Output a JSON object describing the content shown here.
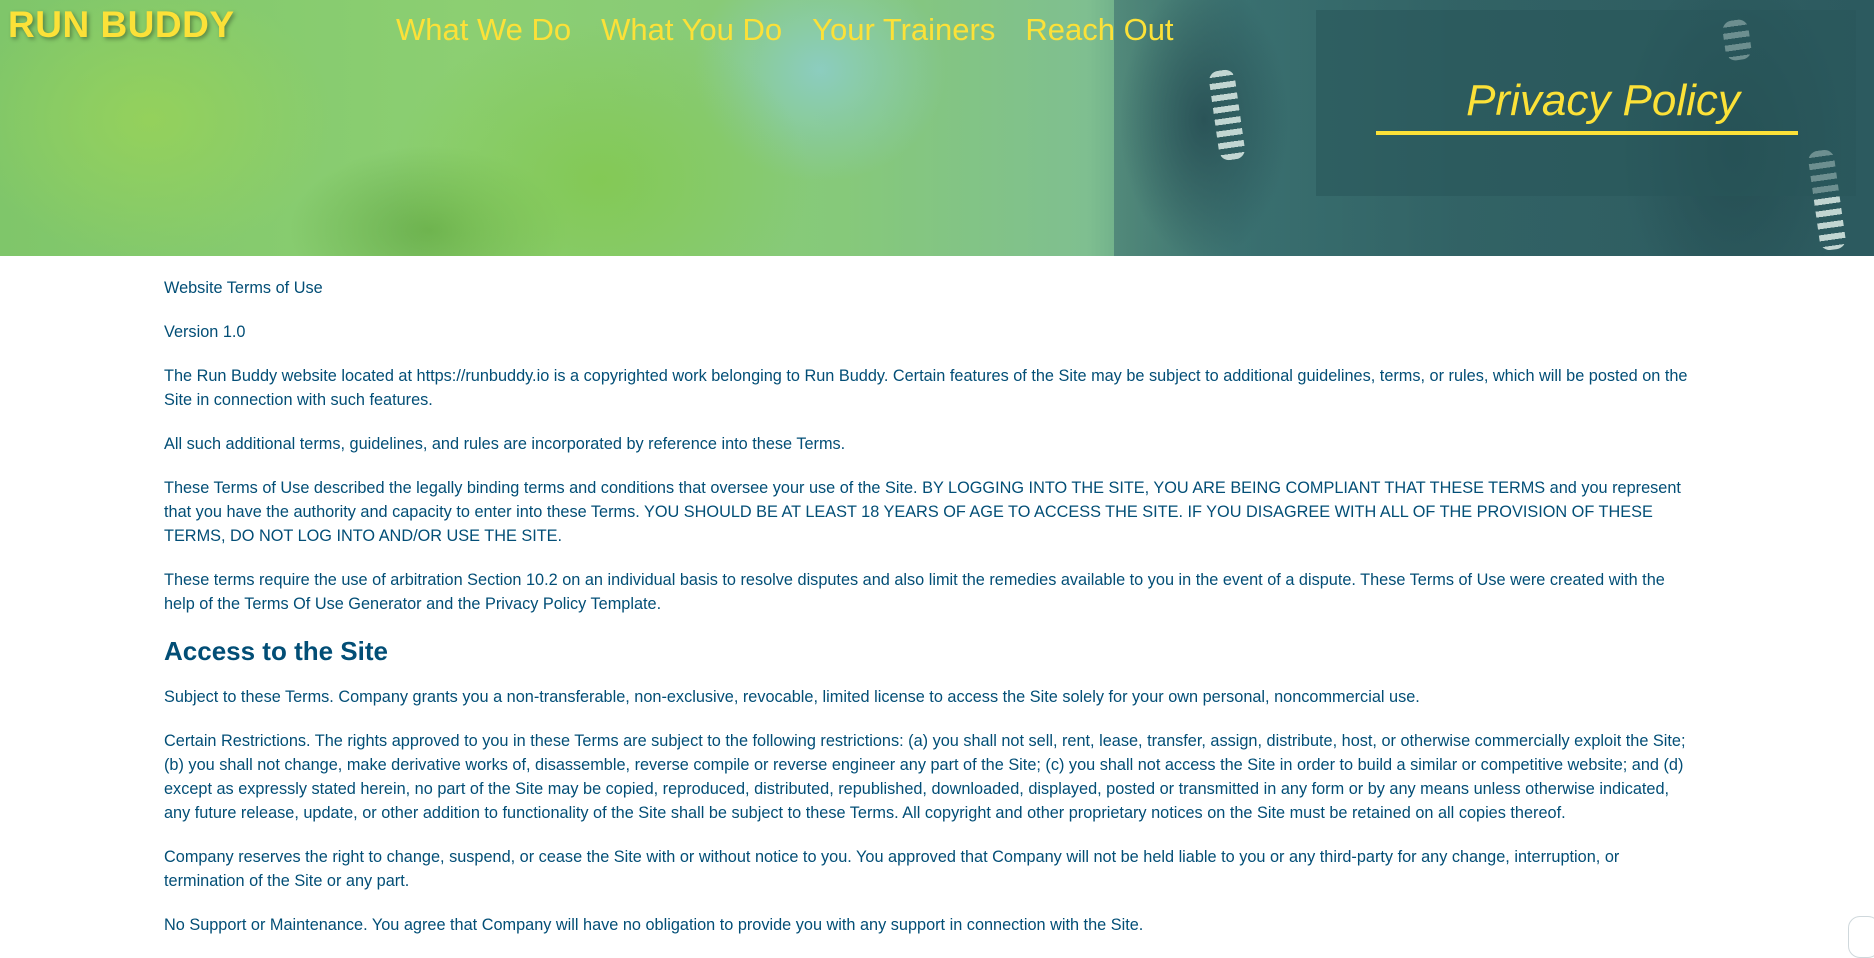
{
  "header": {
    "logo": "RUN BUDDY",
    "nav": [
      "What We Do",
      "What You Do",
      "Your Trainers",
      "Reach Out"
    ],
    "page_title": "Privacy Policy"
  },
  "content": {
    "paragraphs_intro": [
      "Website Terms of Use",
      "Version 1.0",
      "The Run Buddy website located at https://runbuddy.io is a copyrighted work belonging to Run Buddy. Certain features of the Site may be subject to additional guidelines, terms, or rules, which will be posted on the Site in connection with such features.",
      "All such additional terms, guidelines, and rules are incorporated by reference into these Terms.",
      "These Terms of Use described the legally binding terms and conditions that oversee your use of the Site. BY LOGGING INTO THE SITE, YOU ARE BEING COMPLIANT THAT THESE TERMS and you represent that you have the authority and capacity to enter into these Terms. YOU SHOULD BE AT LEAST 18 YEARS OF AGE TO ACCESS THE SITE. IF YOU DISAGREE WITH ALL OF THE PROVISION OF THESE TERMS, DO NOT LOG INTO AND/OR USE THE SITE.",
      "These terms require the use of arbitration Section 10.2 on an individual basis to resolve disputes and also limit the remedies available to you in the event of a dispute. These Terms of Use were created with the help of the Terms Of Use Generator and the Privacy Policy Template."
    ],
    "section_heading": "Access to the Site",
    "paragraphs_access": [
      "Subject to these Terms. Company grants you a non-transferable, non-exclusive, revocable, limited license to access the Site solely for your own personal, noncommercial use.",
      "Certain Restrictions. The rights approved to you in these Terms are subject to the following restrictions: (a) you shall not sell, rent, lease, transfer, assign, distribute, host, or otherwise commercially exploit the Site; (b) you shall not change, make derivative works of, disassemble, reverse compile or reverse engineer any part of the Site; (c) you shall not access the Site in order to build a similar or competitive website; and (d) except as expressly stated herein, no part of the Site may be copied, reproduced, distributed, republished, downloaded, displayed, posted or transmitted in any form or by any means unless otherwise indicated, any future release, update, or other addition to functionality of the Site shall be subject to these Terms. All copyright and other proprietary notices on the Site must be retained on all copies thereof.",
      "Company reserves the right to change, suspend, or cease the Site with or without notice to you. You approved that Company will not be held liable to you or any third-party for any change, interruption, or termination of the Site or any part.",
      "No Support or Maintenance. You agree that Company will have no obligation to provide you with any support in connection with the Site."
    ]
  },
  "colors": {
    "accent": "#fce138",
    "text": "#024e76",
    "background": "#ffffff"
  }
}
